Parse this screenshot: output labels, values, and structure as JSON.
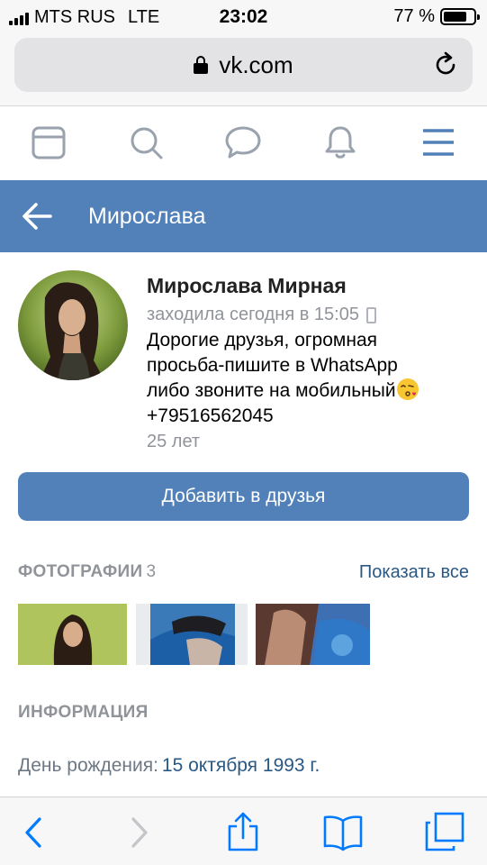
{
  "status_bar": {
    "carrier": "MTS RUS",
    "network": "LTE",
    "time": "23:02",
    "battery": "77 %",
    "battery_level": 0.77
  },
  "browser": {
    "url": "vk.com"
  },
  "vk_nav": {
    "items": [
      "news-icon",
      "search-icon",
      "messages-icon",
      "notifications-icon",
      "menu-icon"
    ],
    "accent": "#5181b8"
  },
  "header": {
    "title": "Мирослава"
  },
  "profile": {
    "name": "Мирослава Мирная",
    "last_seen": "заходила сегодня в 15:05",
    "status_lines": [
      "Дорогие друзья, огромная",
      "просьба-пишите в WhatsApp",
      "либо звоните на мобильный"
    ],
    "phone": "+79516562045",
    "age": "25 лет",
    "add_button": "Добавить в друзья"
  },
  "photos": {
    "title": "ФОТОГРАФИИ",
    "count": "3",
    "show_all": "Показать все"
  },
  "info": {
    "title": "ИНФОРМАЦИЯ",
    "birthday_label": "День рождения:",
    "birthday_value": "15 октября 1993 г."
  },
  "toolbar": {
    "items": [
      "back-icon",
      "forward-icon",
      "share-icon",
      "bookmarks-icon",
      "tabs-icon"
    ]
  }
}
